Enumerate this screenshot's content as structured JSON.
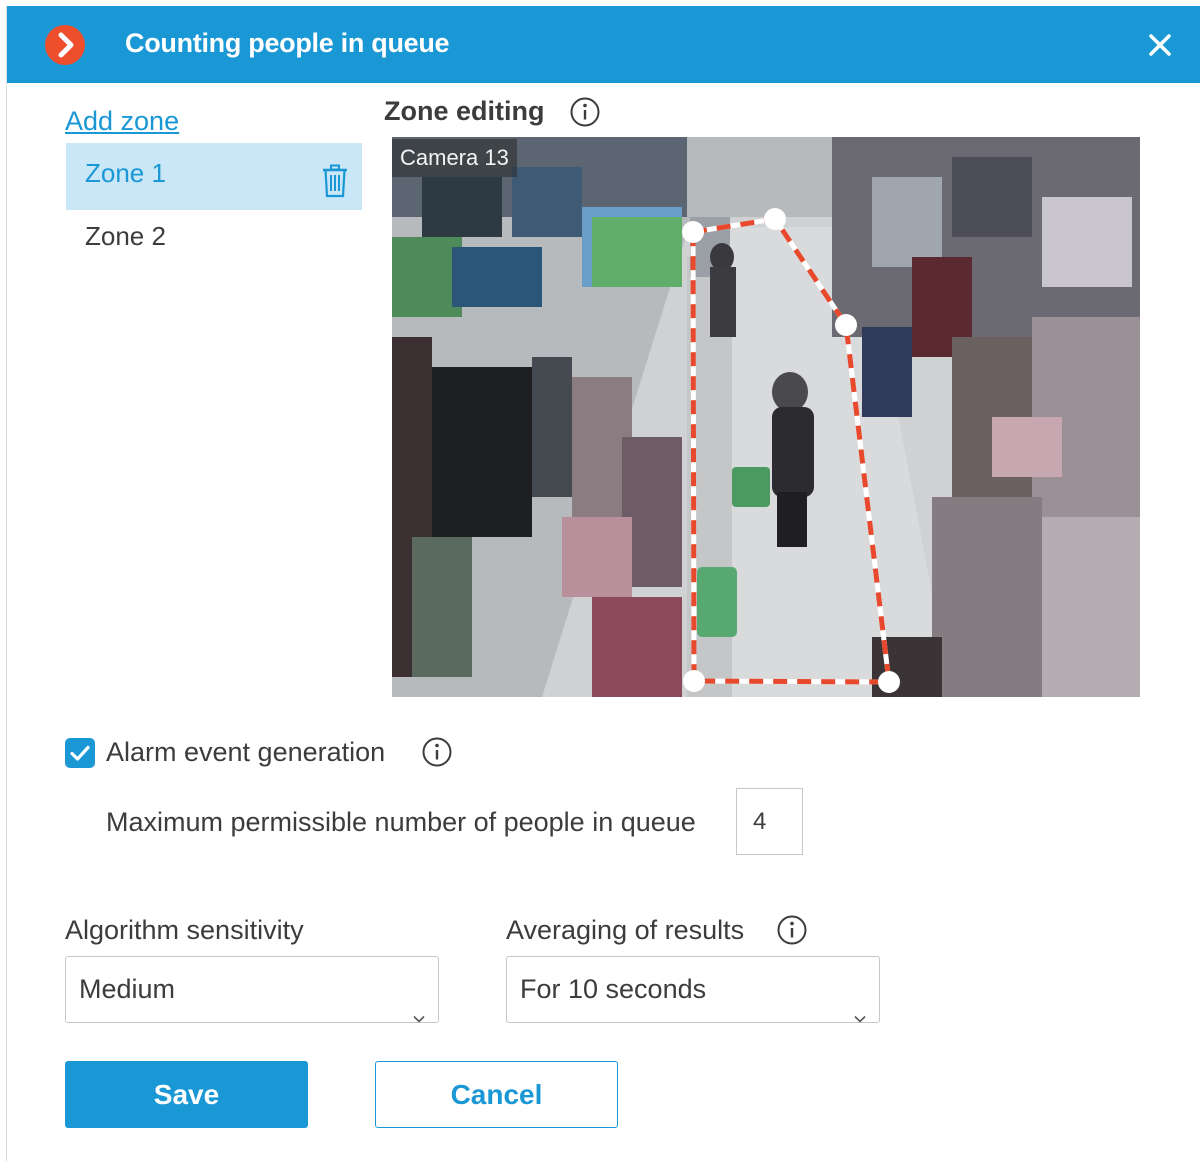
{
  "window": {
    "title": "Counting people in queue",
    "logo_icon": "chevron-right-logo-icon",
    "close_icon": "close-icon"
  },
  "zones": {
    "add_label": "Add zone",
    "items": [
      {
        "label": "Zone 1",
        "selected": true
      },
      {
        "label": "Zone 2",
        "selected": false
      }
    ]
  },
  "editor": {
    "title": "Zone editing",
    "camera_label": "Camera 13"
  },
  "alarm": {
    "enabled": true,
    "label": "Alarm event generation",
    "max_people_label": "Maximum permissible number of people in queue",
    "max_people_value": "4"
  },
  "sensitivity": {
    "label": "Algorithm sensitivity",
    "value": "Medium"
  },
  "averaging": {
    "label": "Averaging of results",
    "value": "For 10 seconds"
  },
  "actions": {
    "save_label": "Save",
    "cancel_label": "Cancel"
  },
  "colors": {
    "accent": "#1a98d5",
    "logo": "#ee4e2c",
    "zone_outline": "#e8492d",
    "selected_bg": "#c9e7f6"
  }
}
